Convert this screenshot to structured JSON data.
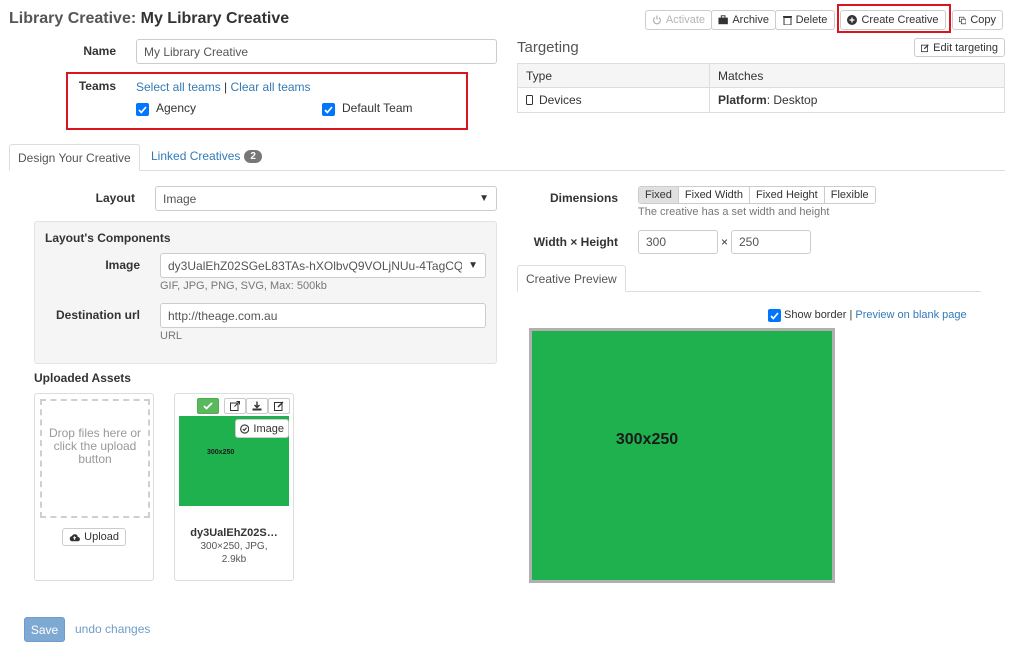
{
  "header": {
    "title_prefix": "Library Creative:",
    "title_name": "My Library Creative",
    "buttons": {
      "activate": "Activate",
      "archive": "Archive",
      "delete": "Delete",
      "create_creative": "Create Creative",
      "copy": "Copy"
    }
  },
  "form": {
    "name_label": "Name",
    "name_value": "My Library Creative",
    "teams_label": "Teams",
    "select_all": "Select all teams",
    "separator": "|",
    "clear_all": "Clear all teams",
    "teams": [
      {
        "label": "Agency",
        "checked": true
      },
      {
        "label": "Default Team",
        "checked": true
      }
    ]
  },
  "targeting": {
    "heading": "Targeting",
    "edit_button": "Edit targeting",
    "columns": [
      "Type",
      "Matches"
    ],
    "rows": [
      {
        "type": "Devices",
        "match_key": "Platform",
        "match_value": ": Desktop"
      }
    ]
  },
  "tabs": {
    "design": "Design Your Creative",
    "linked": "Linked Creatives",
    "linked_count": "2"
  },
  "design": {
    "layout_label": "Layout",
    "layout_value": "Image",
    "components_heading": "Layout's Components",
    "image_label": "Image",
    "image_value": "dy3UalEhZ02SGeL83TAs-hXOlbvQ9VOLjNUu-4TagCQ",
    "image_help": "GIF, JPG, PNG, SVG, Max: 500kb",
    "destination_label": "Destination url",
    "destination_value": "http://theage.com.au",
    "destination_help": "URL",
    "uploaded_heading": "Uploaded Assets",
    "dropzone_text": "Drop files here or click the upload button",
    "upload_button": "Upload",
    "asset": {
      "tag": "Image",
      "thumb_text": "300x250",
      "name": "dy3UalEhZ02S…",
      "meta_line1": "300×250, JPG,",
      "meta_line2": "2.9kb"
    }
  },
  "dimensions": {
    "label": "Dimensions",
    "options": [
      "Fixed",
      "Fixed Width",
      "Fixed Height",
      "Flexible"
    ],
    "selected": "Fixed",
    "help": "The creative has a set width and height",
    "wh_label": "Width × Height",
    "width": "300",
    "times": "×",
    "height": "250"
  },
  "preview": {
    "tab": "Creative Preview",
    "show_border": "Show border",
    "separator": "|",
    "blank_link": "Preview on blank page",
    "box_text": "300x250",
    "box_color": "#1fb14e"
  },
  "footer": {
    "save": "Save",
    "undo": "undo changes"
  }
}
